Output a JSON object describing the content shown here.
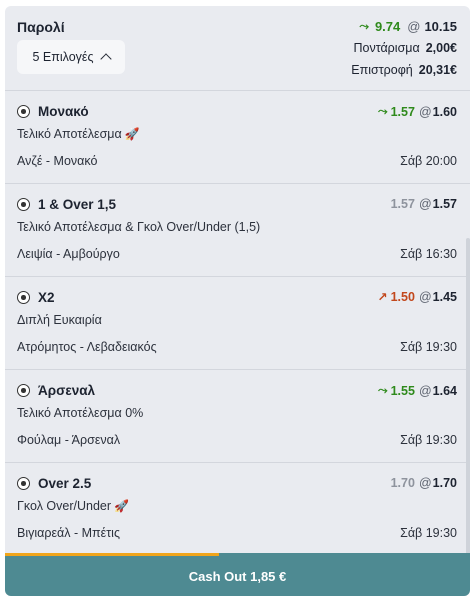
{
  "header": {
    "title": "Παρολί",
    "selections_button": "5 Επιλογές",
    "old_odds": "9.74",
    "new_odds": "10.15",
    "stake_label": "Ποντάρισμα",
    "stake_value": "2,00€",
    "return_label": "Επιστροφή",
    "return_value": "20,31€"
  },
  "at_symbol": "@",
  "selections": [
    {
      "name": "Μονακό",
      "market": "Τελικό Αποτέλεσμα",
      "match": "Ανζέ - Μονακό",
      "time": "Σάβ 20:00",
      "old_odds": "1.57",
      "new_odds": "1.60",
      "trend": "up",
      "boost_icon": "rocket-icon"
    },
    {
      "name": "1 & Over 1,5",
      "market": "Τελικό Αποτέλεσμα & Γκολ Over/Under (1,5)",
      "match": "Λειψία - Αμβούργο",
      "time": "Σάβ 16:30",
      "old_odds": "1.57",
      "new_odds": "1.57",
      "trend": "none"
    },
    {
      "name": "X2",
      "market": "Διπλή Ευκαιρία",
      "match": "Ατρόμητος - Λεβαδειακός",
      "time": "Σάβ 19:30",
      "old_odds": "1.50",
      "new_odds": "1.45",
      "trend": "down"
    },
    {
      "name": "Άρσεναλ",
      "market": "Τελικό Αποτέλεσμα 0%",
      "match": "Φούλαμ - Άρσεναλ",
      "time": "Σάβ 19:30",
      "old_odds": "1.55",
      "new_odds": "1.64",
      "trend": "up"
    },
    {
      "name": "Over 2.5",
      "market": "Γκολ Over/Under",
      "match": "Βιγιαρεάλ - Μπέτις",
      "time": "Σάβ 19:30",
      "old_odds": "1.70",
      "new_odds": "1.70",
      "trend": "none",
      "boost_icon": "rocket-icon"
    }
  ],
  "cash_out": {
    "label": "Cash Out 1,85 €",
    "progress": 0.46
  },
  "colors": {
    "up": "#2f8a1c",
    "down": "#c2471c",
    "neutral": "#8e939d",
    "cash_out_bg": "#4e8a92",
    "progress_fill": "#f0a51b"
  }
}
